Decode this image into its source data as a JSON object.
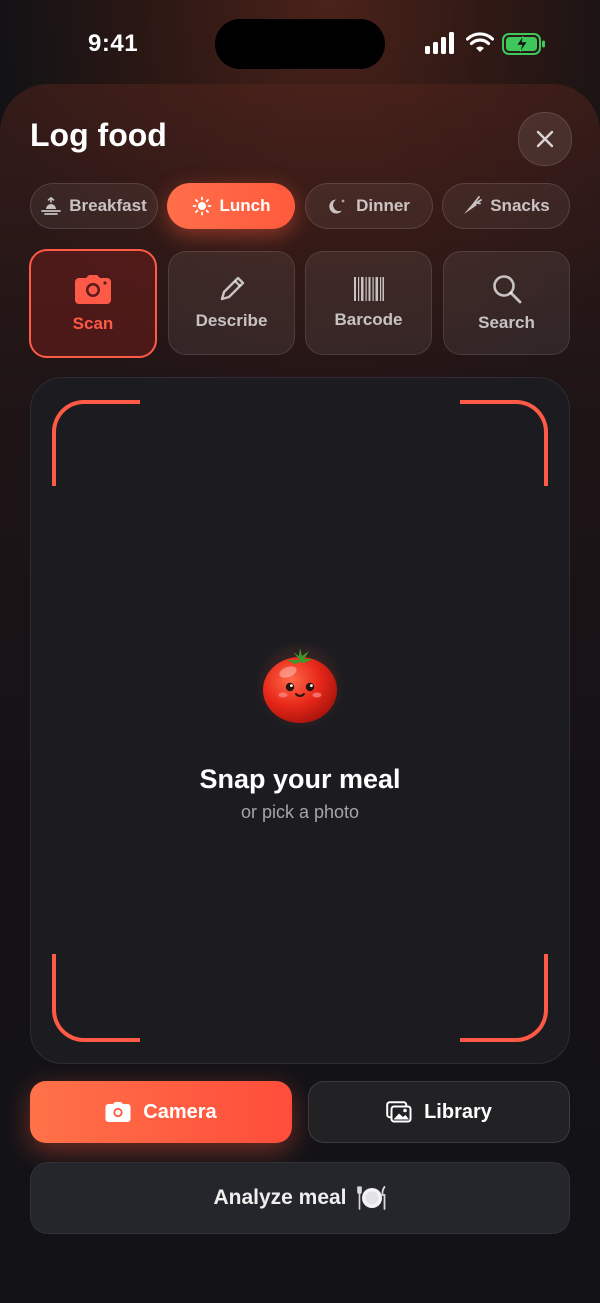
{
  "status_bar": {
    "time": "9:41"
  },
  "header": {
    "title": "Log food",
    "close_icon": "close-icon"
  },
  "meal_tabs": [
    {
      "label": "Breakfast",
      "icon": "sunrise-icon",
      "selected": false
    },
    {
      "label": "Lunch",
      "icon": "sun-icon",
      "selected": true
    },
    {
      "label": "Dinner",
      "icon": "moon-icon",
      "selected": false
    },
    {
      "label": "Snacks",
      "icon": "carrot-icon",
      "selected": false
    }
  ],
  "modes": [
    {
      "label": "Scan",
      "icon": "camera-icon",
      "selected": true
    },
    {
      "label": "Describe",
      "icon": "pencil-icon",
      "selected": false
    },
    {
      "label": "Barcode",
      "icon": "barcode-icon",
      "selected": false
    },
    {
      "label": "Search",
      "icon": "search-icon",
      "selected": false
    }
  ],
  "viewfinder": {
    "mascot": "tomato-mascot",
    "title": "Snap your meal",
    "subtitle": "or pick a photo"
  },
  "actions": {
    "camera_label": "Camera",
    "library_label": "Library",
    "analyze_label": "Analyze meal",
    "analyze_icon": "plate-icon"
  },
  "colors": {
    "accent": "#ff5a3c",
    "accent_light": "#ff7248",
    "background": "#121215",
    "card": "#1c1c20"
  }
}
